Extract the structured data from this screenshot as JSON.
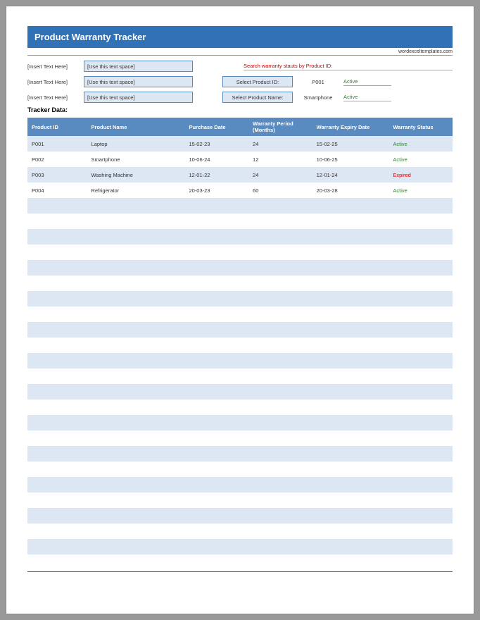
{
  "title": "Product Warranty Tracker",
  "attribution": "wordexceltemplates.com",
  "meta": {
    "label": "[Insert Text Here]",
    "value": "[Use this text space]"
  },
  "search": {
    "header": "Search warranty stauts by Product ID:",
    "row1": {
      "label": "Select Product ID:",
      "value": "P001",
      "status": "Active"
    },
    "row2": {
      "label": "Select Product Name:",
      "value": "Smartphone",
      "status": "Active"
    }
  },
  "tracker_label": "Tracker Data:",
  "columns": {
    "c1": "Product ID",
    "c2": "Product Name",
    "c3": "Purchase Date",
    "c4": "Warranty Period (Months)",
    "c5": "Warranty Expiry Date",
    "c6": "Warranty Status"
  },
  "rows": [
    {
      "pid": "P001",
      "pname": "Laptop",
      "pdate": "15-02-23",
      "wp": "24",
      "exp": "15-02-25",
      "stat": "Active",
      "cls": "green"
    },
    {
      "pid": "P002",
      "pname": "Smartphone",
      "pdate": "10-06-24",
      "wp": "12",
      "exp": "10-06-25",
      "stat": "Active",
      "cls": "green"
    },
    {
      "pid": "P003",
      "pname": "Washing Machine",
      "pdate": "12-01-22",
      "wp": "24",
      "exp": "12-01-24",
      "stat": "Expired",
      "cls": "red"
    },
    {
      "pid": "P004",
      "pname": "Refrigerator",
      "pdate": "20-03-23",
      "wp": "60",
      "exp": "20-03-28",
      "stat": "Active",
      "cls": "green"
    }
  ],
  "empty_rows": 24
}
